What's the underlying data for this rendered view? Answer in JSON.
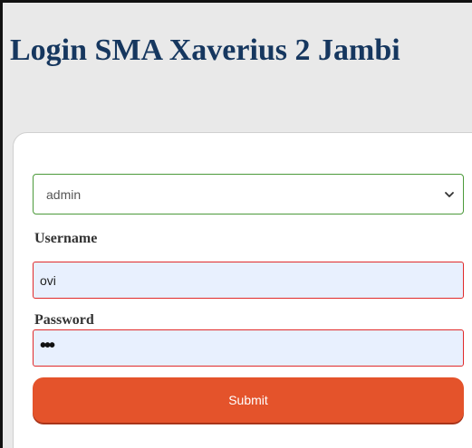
{
  "page": {
    "title": "Login SMA Xaverius 2 Jambi"
  },
  "form": {
    "role_select": {
      "selected": "admin"
    },
    "username": {
      "label": "Username",
      "value": "ovi"
    },
    "password": {
      "label": "Password",
      "masked_value": "•••"
    },
    "submit_label": "Submit"
  },
  "colors": {
    "title": "#16375f",
    "background": "#e9e9e9",
    "submit_button": "#e4532b",
    "select_border": "#4c9a3a",
    "input_border": "#e02a2a",
    "input_fill": "#e8f0fe"
  },
  "icons": {
    "select_chevron": "chevron-down-icon"
  }
}
